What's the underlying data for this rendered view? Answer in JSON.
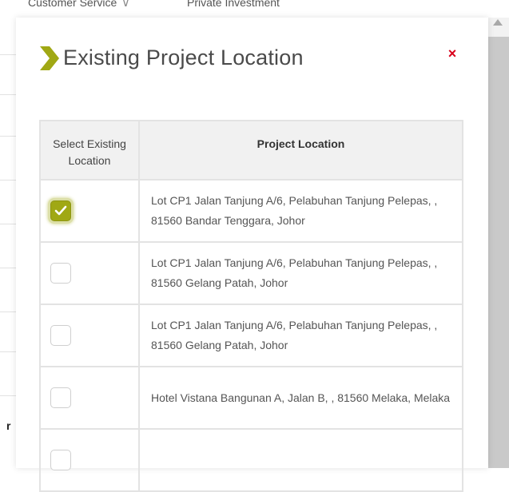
{
  "background": {
    "nav_tab_1": "Customer Service",
    "nav_tab_2": "Private Investment",
    "partial_letter": "r"
  },
  "modal": {
    "title": "Existing Project Location",
    "close_label": "×"
  },
  "table": {
    "headers": {
      "select": "Select Existing Location",
      "location": "Project Location"
    },
    "rows": [
      {
        "checked": true,
        "location": "Lot CP1 Jalan Tanjung A/6, Pelabuhan Tanjung Pelepas, , 81560 Bandar Tenggara, Johor"
      },
      {
        "checked": false,
        "location": "Lot CP1 Jalan Tanjung A/6, Pelabuhan Tanjung Pelepas, , 81560 Gelang Patah, Johor"
      },
      {
        "checked": false,
        "location": "Lot CP1 Jalan Tanjung A/6, Pelabuhan Tanjung Pelepas, , 81560 Gelang Patah, Johor"
      },
      {
        "checked": false,
        "location": "Hotel Vistana Bangunan A, Jalan B, , 81560 Melaka, Melaka"
      },
      {
        "checked": false,
        "location": ""
      }
    ]
  },
  "colors": {
    "accent": "#a0a814",
    "close": "#d9001b"
  },
  "icons": {
    "title": "chevron-right-icon",
    "close": "close-icon",
    "check": "checkmark-icon",
    "nav_dropdown": "chevron-down-icon",
    "scroll": "scroll-up-arrow-icon"
  }
}
